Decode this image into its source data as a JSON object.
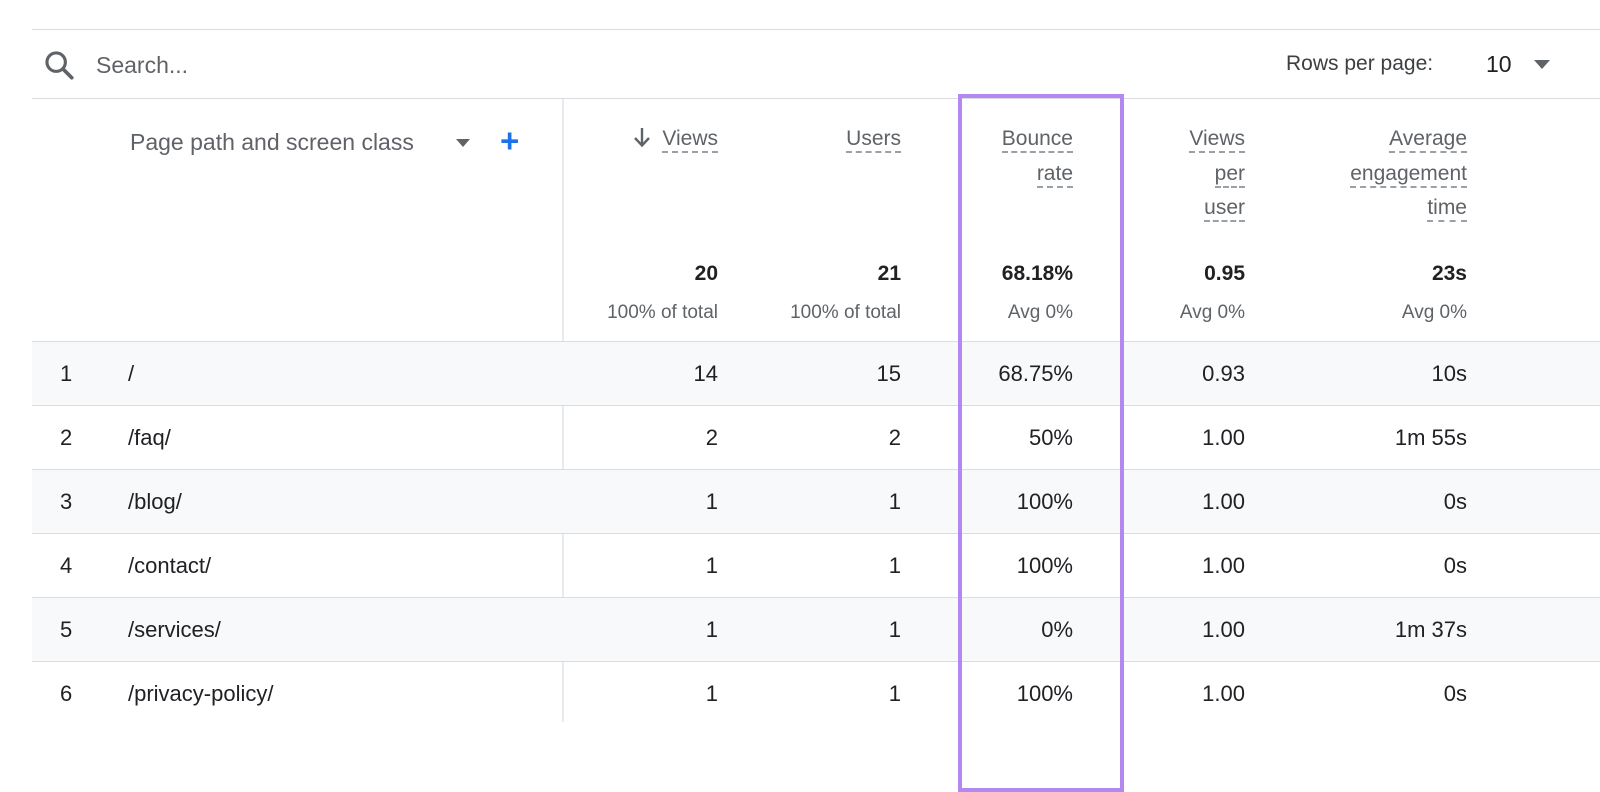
{
  "search": {
    "placeholder": "Search..."
  },
  "pagination": {
    "rows_label": "Rows per page:",
    "rows_value": "10"
  },
  "dimension": {
    "label": "Page path and screen class",
    "add_label": "+"
  },
  "metrics": [
    {
      "key": "views",
      "label_lines": [
        "Views"
      ],
      "sorted": true,
      "total": "20",
      "sub": "100% of total"
    },
    {
      "key": "users",
      "label_lines": [
        "Users"
      ],
      "total": "21",
      "sub": "100% of total"
    },
    {
      "key": "bounce_rate",
      "label_lines": [
        "Bounce",
        "rate"
      ],
      "total": "68.18%",
      "sub": "Avg 0%"
    },
    {
      "key": "views_per_user",
      "label_lines": [
        "Views",
        "per",
        "user"
      ],
      "total": "0.95",
      "sub": "Avg 0%"
    },
    {
      "key": "avg_engagement_time",
      "label_lines": [
        "Average",
        "engagement",
        "time"
      ],
      "total": "23s",
      "sub": "Avg 0%"
    }
  ],
  "rows": [
    {
      "num": "1",
      "path": "/",
      "views": "14",
      "users": "15",
      "bounce_rate": "68.75%",
      "views_per_user": "0.93",
      "avg_engagement_time": "10s"
    },
    {
      "num": "2",
      "path": "/faq/",
      "views": "2",
      "users": "2",
      "bounce_rate": "50%",
      "views_per_user": "1.00",
      "avg_engagement_time": "1m 55s"
    },
    {
      "num": "3",
      "path": "/blog/",
      "views": "1",
      "users": "1",
      "bounce_rate": "100%",
      "views_per_user": "1.00",
      "avg_engagement_time": "0s"
    },
    {
      "num": "4",
      "path": "/contact/",
      "views": "1",
      "users": "1",
      "bounce_rate": "100%",
      "views_per_user": "1.00",
      "avg_engagement_time": "0s"
    },
    {
      "num": "5",
      "path": "/services/",
      "views": "1",
      "users": "1",
      "bounce_rate": "0%",
      "views_per_user": "1.00",
      "avg_engagement_time": "1m 37s"
    },
    {
      "num": "6",
      "path": "/privacy-policy/",
      "views": "1",
      "users": "1",
      "bounce_rate": "100%",
      "views_per_user": "1.00",
      "avg_engagement_time": "0s"
    }
  ],
  "colors": {
    "accent": "#1a73e8",
    "highlight": "#b388ef",
    "row_shade": "#f8f9fa"
  },
  "icons": {
    "search": "search-icon",
    "caret": "caret-down-icon",
    "sort": "arrow-down-icon"
  }
}
